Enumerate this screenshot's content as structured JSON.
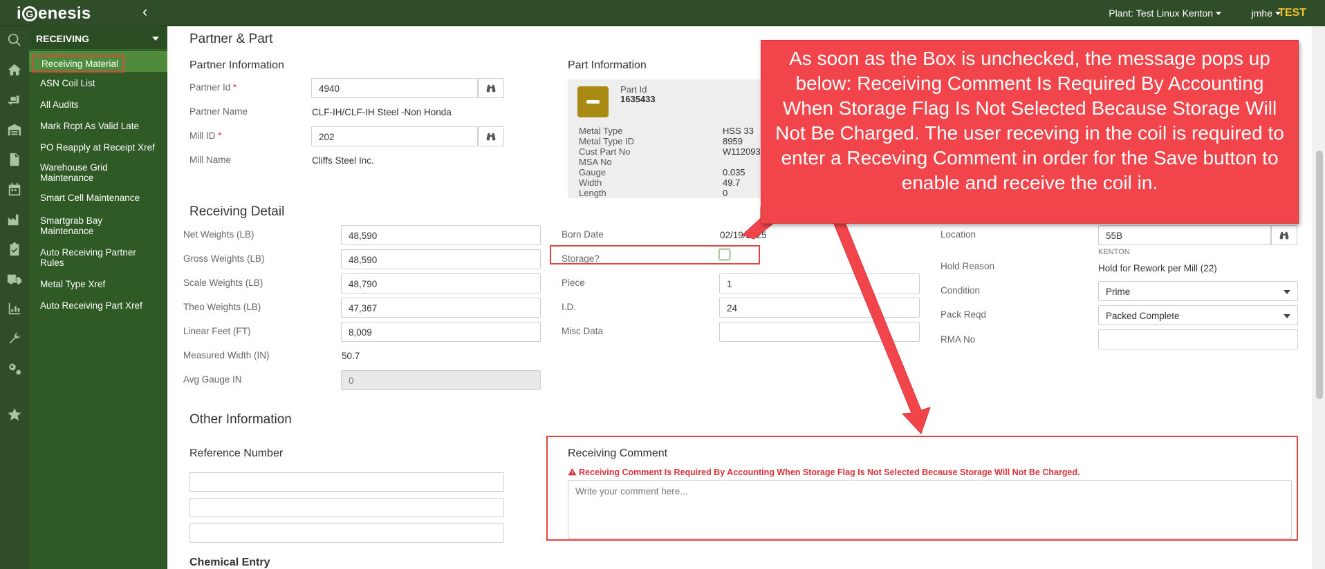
{
  "header": {
    "logo_text": "iGenesis",
    "plant_label": "Plant: Test Linux Kenton",
    "user_label": "jmhe",
    "env_label": "TEST"
  },
  "rail_icons": [
    "search-icon",
    "home-icon",
    "truck-loading-icon",
    "warehouse-icon",
    "document-icon",
    "calendar-icon",
    "factory-icon",
    "clipboard-check-icon",
    "truck-icon",
    "list-chart-icon",
    "wrench-icon",
    "gears-icon",
    "star-icon"
  ],
  "sidebar": {
    "section": "RECEIVING",
    "items": [
      {
        "label": "Receiving Material",
        "active": true
      },
      {
        "label": "ASN Coil List"
      },
      {
        "label": "All Audits"
      },
      {
        "label": "Mark Rcpt As Valid Late"
      },
      {
        "label": "PO Reapply at Receipt Xref"
      },
      {
        "label": "Warehouse Grid Maintenance"
      },
      {
        "label": "Smart Cell Maintenance"
      },
      {
        "label": "Smartgrab Bay Maintenance"
      },
      {
        "label": "Auto Receiving Partner Rules"
      },
      {
        "label": "Metal Type Xref"
      },
      {
        "label": "Auto Receiving Part Xref"
      }
    ]
  },
  "partner_part": {
    "title": "Partner & Part",
    "partner_info_title": "Partner Information",
    "partner_id_label": "Partner Id",
    "partner_id_value": "4940",
    "partner_name_label": "Partner Name",
    "partner_name_value": "CLF-IH/CLF-IH Steel -Non Honda",
    "mill_id_label": "Mill ID",
    "mill_id_value": "202",
    "mill_name_label": "Mill Name",
    "mill_name_value": "Cliffs Steel Inc.",
    "required_mark": "*",
    "part_info_title": "Part Information",
    "part_id_label": "Part Id",
    "part_id_value": "1635433",
    "part_rows": [
      {
        "label": "Metal Type",
        "value": "HSS 33"
      },
      {
        "label": "Metal Type ID",
        "value": "8959"
      },
      {
        "label": "Cust Part No",
        "value": "W112093"
      },
      {
        "label": "MSA No",
        "value": ""
      },
      {
        "label": "Gauge",
        "value": "0.035"
      },
      {
        "label": "Width",
        "value": "49.7"
      },
      {
        "label": "Length",
        "value": "0"
      }
    ]
  },
  "receiving_detail": {
    "title": "Receiving Detail",
    "col1": [
      {
        "label": "Net Weights (LB)",
        "value": "48,590"
      },
      {
        "label": "Gross Weights (LB)",
        "value": "48,590"
      },
      {
        "label": "Scale Weights (LB)",
        "value": "48,790"
      },
      {
        "label": "Theo Weights (LB)",
        "value": "47,367"
      },
      {
        "label": "Linear Feet (FT)",
        "value": "8,009"
      }
    ],
    "measured_width_label": "Measured Width (IN)",
    "measured_width_value": "50.7",
    "avg_gauge_label": "Avg Gauge IN",
    "avg_gauge_value": "0",
    "born_date_label": "Born Date",
    "born_date_value": "02/19/2025",
    "storage_label": "Storage?",
    "storage_checked": false,
    "piece_label": "Piece",
    "piece_value": "1",
    "id_label": "I.D.",
    "id_value": "24",
    "misc_label": "Misc Data",
    "misc_value": "",
    "location_label": "Location",
    "location_value": "55B",
    "location_sub": "KENTON",
    "hold_reason_label": "Hold Reason",
    "hold_reason_value": "Hold for Rework per Mill (22)",
    "condition_label": "Condition",
    "condition_value": "Prime",
    "pack_label": "Pack Reqd",
    "pack_value": "Packed Complete",
    "rma_label": "RMA No",
    "rma_value": ""
  },
  "other_info": {
    "title": "Other Information",
    "reference_label": "Reference Number",
    "reference_values": [
      "",
      "",
      ""
    ],
    "comment_label": "Receiving Comment",
    "comment_warning": "Receiving Comment Is Required By Accounting When Storage Flag Is Not Selected Because Storage Will Not Be Charged.",
    "comment_placeholder": "Write your comment here...",
    "chemical_title": "Chemical Entry"
  },
  "annotation": {
    "text": "As soon as the Box is unchecked, the message pops up below: Receiving Comment Is Required By Accounting When Storage Flag Is Not Selected Because Storage Will Not Be Charged. The user receving in the coil is required to enter a Receving Comment in order for the Save button to enable and receive the coil in.",
    "color": "#f2454b",
    "highlight_color": "#e0453f"
  },
  "colors": {
    "header_bg": "#2e4d28",
    "sidebar_bg": "#2f5a26",
    "active_item_bg": "#4e8c3c",
    "env_badge": "#f2c12e",
    "error_text": "#d9323a",
    "part_icon": "#a98a12"
  }
}
